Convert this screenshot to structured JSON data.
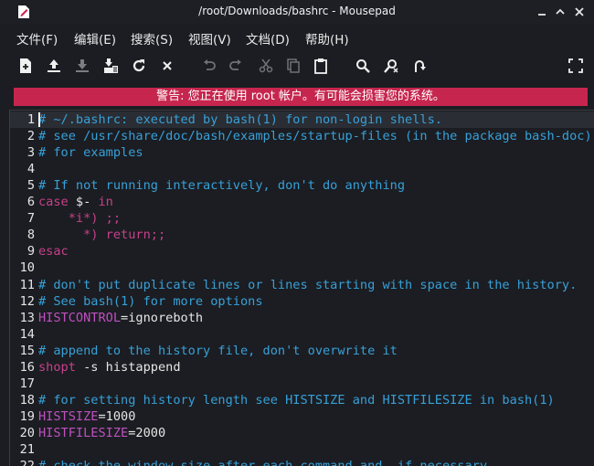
{
  "window": {
    "title": "/root/Downloads/bashrc - Mousepad"
  },
  "menu": [
    {
      "label": "文件(F)"
    },
    {
      "label": "编辑(E)"
    },
    {
      "label": "搜索(S)"
    },
    {
      "label": "视图(V)"
    },
    {
      "label": "文档(D)"
    },
    {
      "label": "帮助(H)"
    }
  ],
  "toolbar_icons": [
    "new-document",
    "open",
    "save",
    "save-as",
    "reload",
    "close",
    "undo",
    "redo",
    "cut",
    "copy",
    "paste",
    "find",
    "find-replace",
    "go-to-line",
    "fullscreen"
  ],
  "warning": "警告: 您正在使用 root 帐户。有可能会损害您的系统。",
  "colors": {
    "warning_bg": "#c6264e",
    "comment": "#38a0d8",
    "keyword": "#c8408a",
    "variable": "#c050c0"
  },
  "lines": [
    {
      "n": "1",
      "segs": [
        {
          "t": "# ~/.bashrc: executed by bash(1) for non-login shells.",
          "c": "comment"
        }
      ]
    },
    {
      "n": "2",
      "segs": [
        {
          "t": "# see /usr/share/doc/bash/examples/startup-files (in the package bash-doc)",
          "c": "comment"
        }
      ]
    },
    {
      "n": "3",
      "segs": [
        {
          "t": "# for examples",
          "c": "comment"
        }
      ]
    },
    {
      "n": "4",
      "segs": []
    },
    {
      "n": "5",
      "segs": [
        {
          "t": "# If not running interactively, don't do anything",
          "c": "comment"
        }
      ]
    },
    {
      "n": "6",
      "segs": [
        {
          "t": "case ",
          "c": "key"
        },
        {
          "t": "$- ",
          "c": "text"
        },
        {
          "t": "in",
          "c": "key"
        }
      ]
    },
    {
      "n": "7",
      "segs": [
        {
          "t": "    *i*) ;;",
          "c": "key"
        }
      ]
    },
    {
      "n": "8",
      "segs": [
        {
          "t": "      *) return;;",
          "c": "key"
        }
      ]
    },
    {
      "n": "9",
      "segs": [
        {
          "t": "esac",
          "c": "key"
        }
      ]
    },
    {
      "n": "10",
      "segs": []
    },
    {
      "n": "11",
      "segs": [
        {
          "t": "# don't put duplicate lines or lines starting with space in the history.",
          "c": "comment"
        }
      ]
    },
    {
      "n": "12",
      "segs": [
        {
          "t": "# See bash(1) for more options",
          "c": "comment"
        }
      ]
    },
    {
      "n": "13",
      "segs": [
        {
          "t": "HISTCONTROL",
          "c": "var"
        },
        {
          "t": "=ignoreboth",
          "c": "text"
        }
      ]
    },
    {
      "n": "14",
      "segs": []
    },
    {
      "n": "15",
      "segs": [
        {
          "t": "# append to the history file, don't overwrite it",
          "c": "comment"
        }
      ]
    },
    {
      "n": "16",
      "segs": [
        {
          "t": "shopt",
          "c": "key"
        },
        {
          "t": " -s histappend",
          "c": "text"
        }
      ]
    },
    {
      "n": "17",
      "segs": []
    },
    {
      "n": "18",
      "segs": [
        {
          "t": "# for setting history length see HISTSIZE and HISTFILESIZE in bash(1)",
          "c": "comment"
        }
      ]
    },
    {
      "n": "19",
      "segs": [
        {
          "t": "HISTSIZE",
          "c": "var"
        },
        {
          "t": "=1000",
          "c": "text"
        }
      ]
    },
    {
      "n": "20",
      "segs": [
        {
          "t": "HISTFILESIZE",
          "c": "var"
        },
        {
          "t": "=2000",
          "c": "text"
        }
      ]
    },
    {
      "n": "21",
      "segs": []
    },
    {
      "n": "22",
      "segs": [
        {
          "t": "# check the window size after each command and, if necessary,",
          "c": "comment"
        }
      ]
    }
  ]
}
